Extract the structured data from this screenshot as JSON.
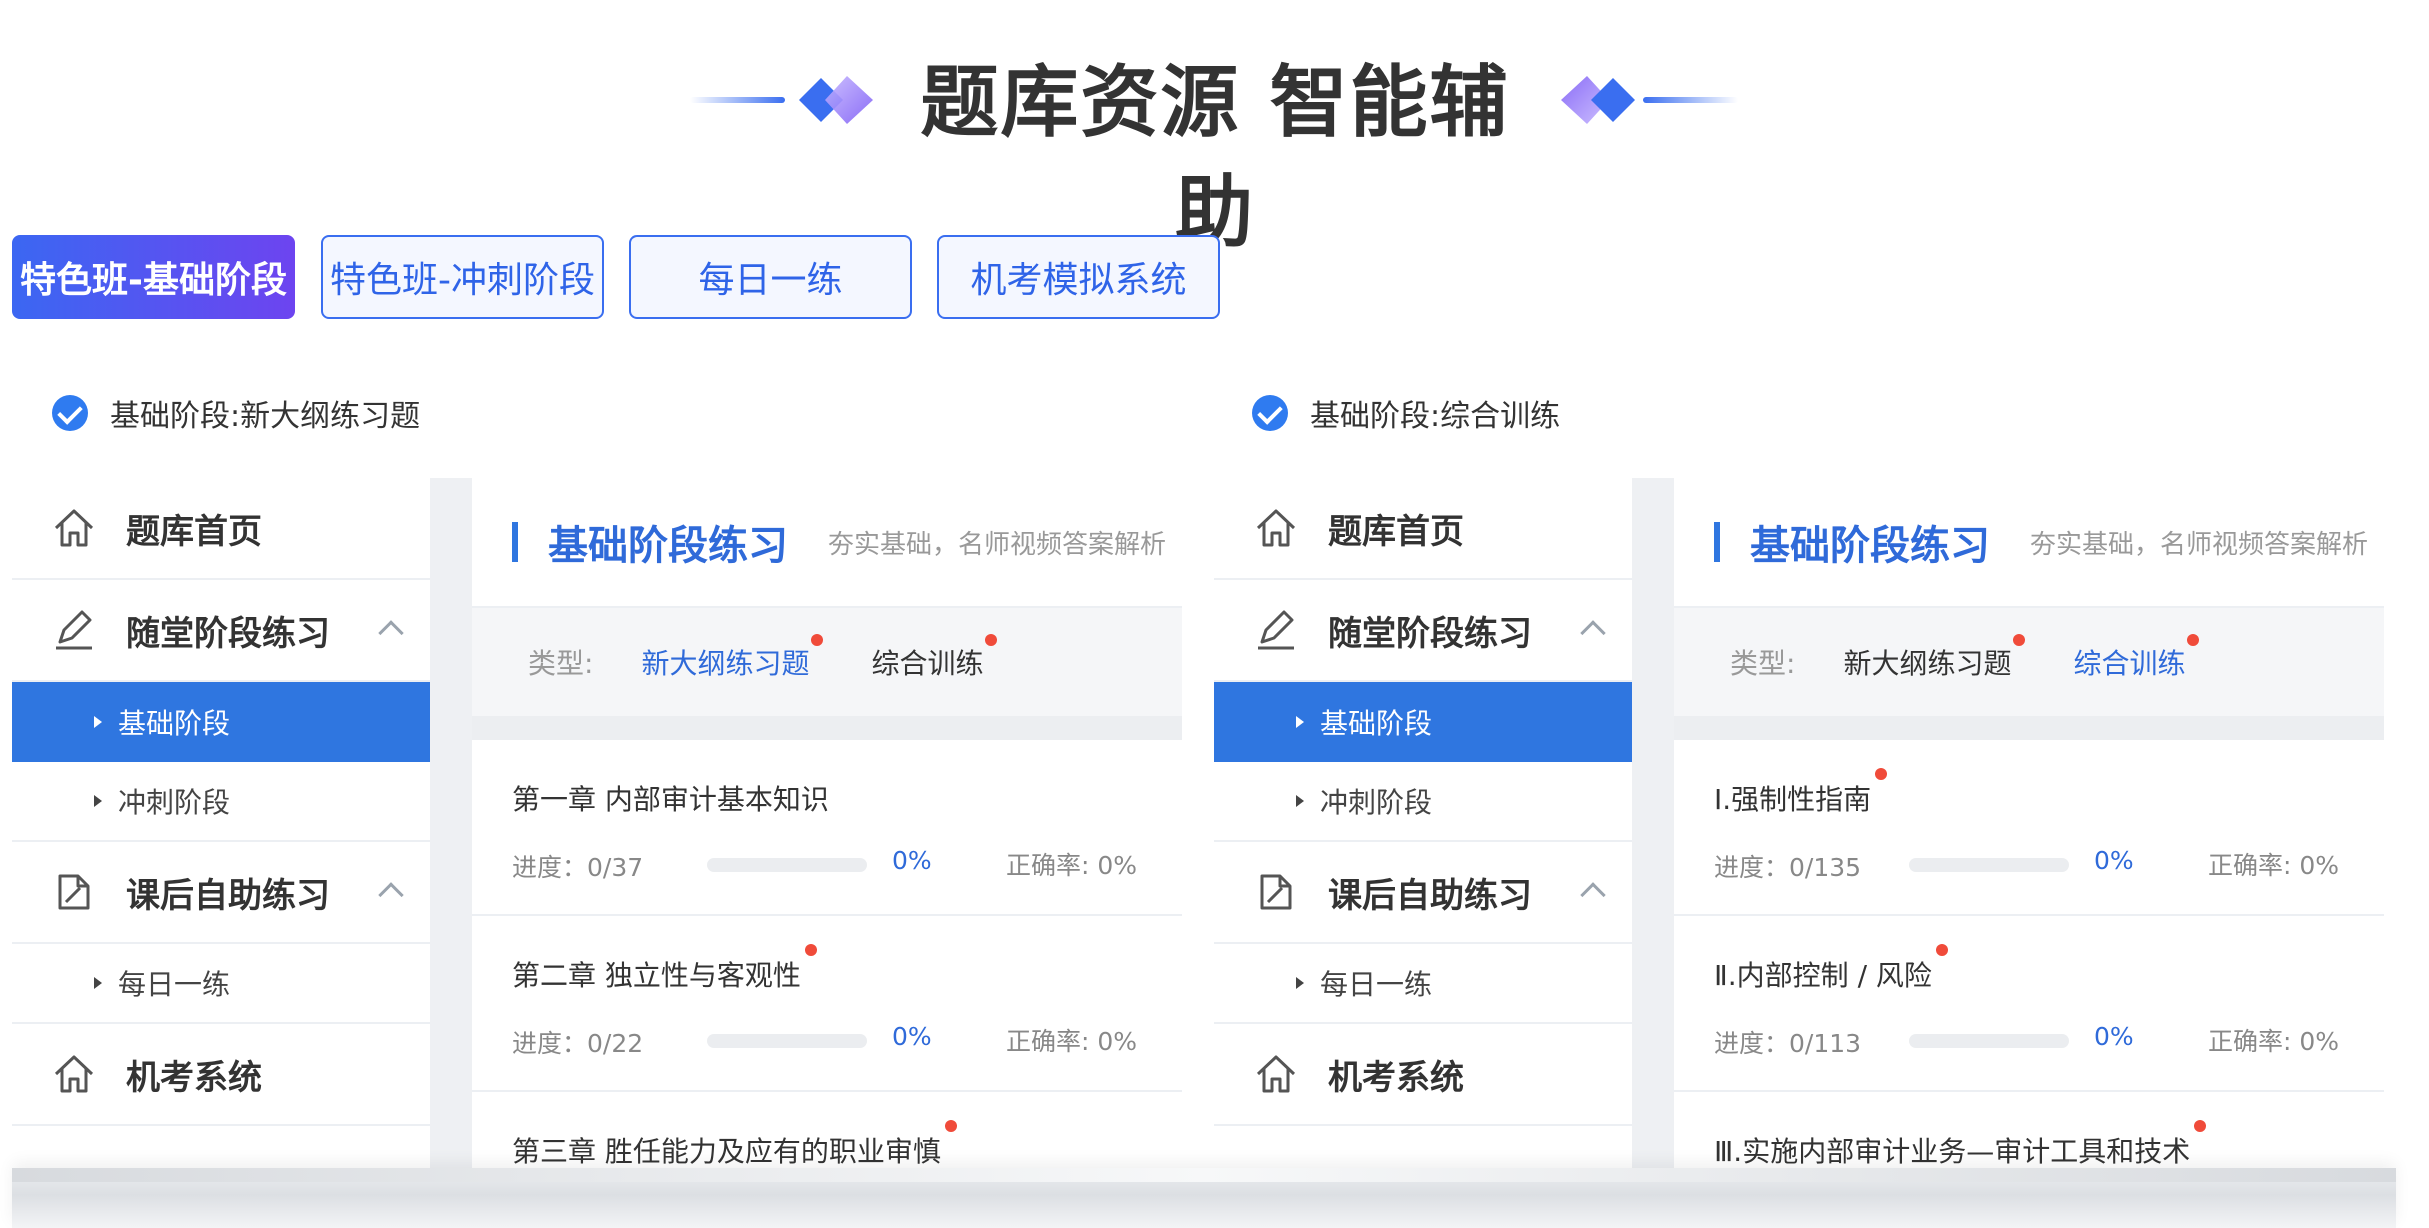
{
  "header": {
    "title": "题库资源 智能辅助"
  },
  "colors": {
    "accent": "#2f6ad9",
    "selected_bg": "#2f76e0",
    "tab_gradient_start": "#3b67f2",
    "tab_gradient_end": "#6d44f0",
    "dot": "#f04b3a"
  },
  "tabs": [
    {
      "label": "特色班-基础阶段",
      "active": true
    },
    {
      "label": "特色班-冲刺阶段",
      "active": false
    },
    {
      "label": "每日一练",
      "active": false
    },
    {
      "label": "机考模拟系统",
      "active": false
    }
  ],
  "sections": [
    {
      "caption": "基础阶段:新大纲练习题",
      "sidebar": {
        "home": "题库首页",
        "class_practice": "随堂阶段练习",
        "basic_stage": "基础阶段",
        "sprint_stage": "冲刺阶段",
        "after_class": "课后自助练习",
        "daily": "每日一练",
        "exam_system": "机考系统"
      },
      "main": {
        "title": "基础阶段练习",
        "subtitle": "夯实基础，名师视频答案解析",
        "type_label": "类型:",
        "type_options": [
          "新大纲练习题",
          "综合训练"
        ],
        "selected_type": "新大纲练习题",
        "items": [
          {
            "name": "第一章 内部审计基本知识",
            "progress": "进度：0/37",
            "percent": "0%",
            "accuracy": "正确率: 0%"
          },
          {
            "name": "第二章 独立性与客观性",
            "progress": "进度：0/22",
            "percent": "0%",
            "accuracy": "正确率: 0%"
          },
          {
            "name": "第三章 胜任能力及应有的职业审慎"
          }
        ]
      }
    },
    {
      "caption": "基础阶段:综合训练",
      "sidebar": {
        "home": "题库首页",
        "class_practice": "随堂阶段练习",
        "basic_stage": "基础阶段",
        "sprint_stage": "冲刺阶段",
        "after_class": "课后自助练习",
        "daily": "每日一练",
        "exam_system": "机考系统"
      },
      "main": {
        "title": "基础阶段练习",
        "subtitle": "夯实基础，名师视频答案解析",
        "type_label": "类型:",
        "type_options": [
          "新大纲练习题",
          "综合训练"
        ],
        "selected_type": "综合训练",
        "items": [
          {
            "name": "Ⅰ.强制性指南",
            "progress": "进度：0/135",
            "percent": "0%",
            "accuracy": "正确率: 0%"
          },
          {
            "name": "Ⅱ.内部控制 / 风险",
            "progress": "进度：0/113",
            "percent": "0%",
            "accuracy": "正确率: 0%"
          },
          {
            "name": "Ⅲ.实施内部审计业务—审计工具和技术"
          }
        ]
      }
    }
  ]
}
